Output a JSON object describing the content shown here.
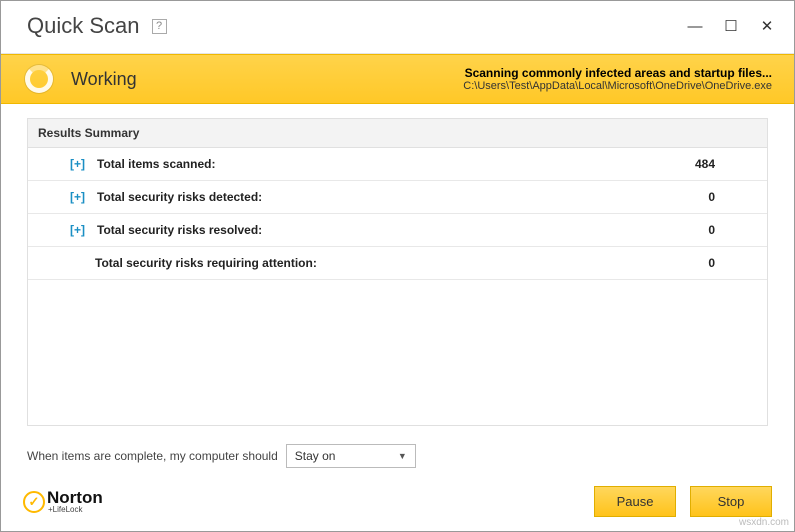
{
  "window": {
    "title": "Quick Scan",
    "help_glyph": "?",
    "controls": {
      "min": "—",
      "max": "☐",
      "close": "✕"
    }
  },
  "status": {
    "label": "Working",
    "scan_title": "Scanning commonly infected areas and startup files...",
    "scan_path": "C:\\Users\\Test\\AppData\\Local\\Microsoft\\OneDrive\\OneDrive.exe"
  },
  "results": {
    "header": "Results Summary",
    "rows": [
      {
        "expand": "[+]",
        "label": "Total items scanned:",
        "value": "484"
      },
      {
        "expand": "[+]",
        "label": "Total security risks detected:",
        "value": "0"
      },
      {
        "expand": "[+]",
        "label": "Total security risks resolved:",
        "value": "0"
      },
      {
        "expand": "",
        "label": "Total security risks requiring attention:",
        "value": "0"
      }
    ]
  },
  "post_scan": {
    "prompt": "When items are complete, my computer should",
    "selected": "Stay on"
  },
  "footer": {
    "logo_name": "Norton",
    "logo_sub": "+LifeLock",
    "pause": "Pause",
    "stop": "Stop"
  },
  "watermark": "wsxdn.com"
}
